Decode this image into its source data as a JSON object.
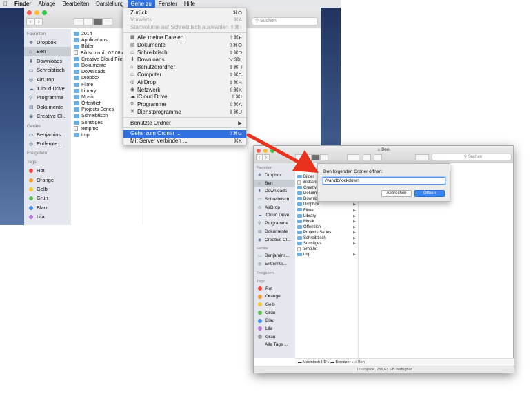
{
  "menubar": {
    "items": [
      "Finder",
      "Ablage",
      "Bearbeiten",
      "Darstellung",
      "Gehe zu",
      "Fenster",
      "Hilfe"
    ],
    "active": "Gehe zu"
  },
  "window1": {
    "search_placeholder": "Suchen",
    "sidebar": {
      "favoriten_header": "Favoriten",
      "favoriten": [
        "Dropbox",
        "Ben",
        "Downloads",
        "Schreibtisch",
        "AirDrop",
        "iCloud Drive",
        "Programme",
        "Dokumente",
        "Creative Cl..."
      ],
      "geraete_header": "Geräte",
      "geraete": [
        "Benjamins...",
        "Entfernte..."
      ],
      "freigaben_header": "Freigaben",
      "tags_header": "Tags",
      "tags": [
        {
          "name": "Rot",
          "color": "#f2453c"
        },
        {
          "name": "Orange",
          "color": "#f39a2b"
        },
        {
          "name": "Gelb",
          "color": "#f2c92e"
        },
        {
          "name": "Grün",
          "color": "#5dc152"
        },
        {
          "name": "Blau",
          "color": "#3e8ef0"
        },
        {
          "name": "Lila",
          "color": "#b774d8"
        }
      ]
    },
    "files": [
      {
        "name": "2014",
        "kind": "folder"
      },
      {
        "name": "Applications",
        "kind": "folder"
      },
      {
        "name": "Bilder",
        "kind": "folder"
      },
      {
        "name": "Bildschirmf...07.08.4",
        "kind": "file"
      },
      {
        "name": "Creative Cloud Files",
        "kind": "folder"
      },
      {
        "name": "Dokumente",
        "kind": "folder"
      },
      {
        "name": "Downloads",
        "kind": "folder"
      },
      {
        "name": "Dropbox",
        "kind": "folder"
      },
      {
        "name": "Filme",
        "kind": "folder"
      },
      {
        "name": "Library",
        "kind": "folder"
      },
      {
        "name": "Musik",
        "kind": "folder"
      },
      {
        "name": "Öffentlich",
        "kind": "folder"
      },
      {
        "name": "Projects Series",
        "kind": "folder"
      },
      {
        "name": "Schreibtisch",
        "kind": "folder"
      },
      {
        "name": "Sonstiges",
        "kind": "folder"
      },
      {
        "name": "temp.txt",
        "kind": "file"
      },
      {
        "name": "tmp",
        "kind": "folder"
      }
    ]
  },
  "menu": {
    "items": [
      {
        "label": "Zurück",
        "shortcut": "⌘Ö",
        "state": "normal",
        "icon": ""
      },
      {
        "label": "Vorwärts",
        "shortcut": "⌘Ä",
        "state": "disabled",
        "icon": ""
      },
      {
        "label": "Startvolume auf Schreibtisch auswählen",
        "shortcut": "⇧⌘↑",
        "state": "disabled",
        "icon": ""
      },
      {
        "label": "Alle meine Dateien",
        "shortcut": "⇧⌘F",
        "state": "normal",
        "icon": "▦"
      },
      {
        "label": "Dokumente",
        "shortcut": "⇧⌘O",
        "state": "normal",
        "icon": "▤"
      },
      {
        "label": "Schreibtisch",
        "shortcut": "⇧⌘D",
        "state": "normal",
        "icon": "▭"
      },
      {
        "label": "Downloads",
        "shortcut": "⌥⌘L",
        "state": "normal",
        "icon": "⬇"
      },
      {
        "label": "Benutzerordner",
        "shortcut": "⇧⌘H",
        "state": "normal",
        "icon": "⌂"
      },
      {
        "label": "Computer",
        "shortcut": "⇧⌘C",
        "state": "normal",
        "icon": "▭"
      },
      {
        "label": "AirDrop",
        "shortcut": "⇧⌘R",
        "state": "normal",
        "icon": "◎"
      },
      {
        "label": "Netzwerk",
        "shortcut": "⇧⌘K",
        "state": "normal",
        "icon": "◉"
      },
      {
        "label": "iCloud Drive",
        "shortcut": "⇧⌘I",
        "state": "normal",
        "icon": "☁"
      },
      {
        "label": "Programme",
        "shortcut": "⇧⌘A",
        "state": "normal",
        "icon": "⚲"
      },
      {
        "label": "Dienstprogramme",
        "shortcut": "⇧⌘U",
        "state": "normal",
        "icon": "✕"
      },
      {
        "label": "Benutzte Ordner",
        "shortcut": "▶",
        "state": "normal",
        "icon": ""
      },
      {
        "label": "Gehe zum Ordner ...",
        "shortcut": "⇧⌘G",
        "state": "highlighted",
        "icon": ""
      },
      {
        "label": "Mit Server verbinden ...",
        "shortcut": "⌘K",
        "state": "normal",
        "icon": ""
      }
    ]
  },
  "window2": {
    "title": "Ben",
    "search_placeholder": "Suchen",
    "sidebar": {
      "favoriten_header": "Favoriten",
      "favoriten": [
        "Dropbox",
        "Ben",
        "Downloads",
        "Schreibtisch",
        "AirDrop",
        "iCloud Drive",
        "Programme",
        "Dokumente",
        "Creative Cl..."
      ],
      "geraete_header": "Geräte",
      "geraete": [
        "Benjamins...",
        "Entfernte..."
      ],
      "freigaben_header": "Freigaben",
      "tags_header": "Tags",
      "tags": [
        {
          "name": "Rot",
          "color": "#f2453c"
        },
        {
          "name": "Orange",
          "color": "#f39a2b"
        },
        {
          "name": "Gelb",
          "color": "#f2c92e"
        },
        {
          "name": "Grün",
          "color": "#5dc152"
        },
        {
          "name": "Blau",
          "color": "#3e8ef0"
        },
        {
          "name": "Lila",
          "color": "#b774d8"
        },
        {
          "name": "Grau",
          "color": "#9a9a9a"
        }
      ],
      "all_tags": "Alle Tags ..."
    },
    "files": [
      {
        "name": "Bilder",
        "kind": "folder"
      },
      {
        "name": "Bildschi",
        "kind": "file"
      },
      {
        "name": "Creative",
        "kind": "folder"
      },
      {
        "name": "Dokume",
        "kind": "folder"
      },
      {
        "name": "Downlo",
        "kind": "folder"
      },
      {
        "name": "Dropbox",
        "kind": "folder"
      },
      {
        "name": "Filme",
        "kind": "folder"
      },
      {
        "name": "Library",
        "kind": "folder"
      },
      {
        "name": "Musik",
        "kind": "folder"
      },
      {
        "name": "Öffentlich",
        "kind": "folder"
      },
      {
        "name": "Projects Series",
        "kind": "folder"
      },
      {
        "name": "Schreibtisch",
        "kind": "folder"
      },
      {
        "name": "Sonstiges",
        "kind": "folder"
      },
      {
        "name": "temp.txt",
        "kind": "file"
      },
      {
        "name": "tmp",
        "kind": "folder"
      }
    ],
    "path": [
      "Macintosh HD",
      "Benutzer",
      "Ben"
    ],
    "status": "17 Objekte, 256,63 GB verfügbar"
  },
  "dialog": {
    "title": "Den folgenden Ordner öffnen:",
    "input_value": "/var/db/lockdown",
    "cancel_label": "Abbrechen",
    "open_label": "Öffnen"
  },
  "colors": {
    "highlight": "#2f6fe0",
    "arrow": "#e8321e"
  }
}
